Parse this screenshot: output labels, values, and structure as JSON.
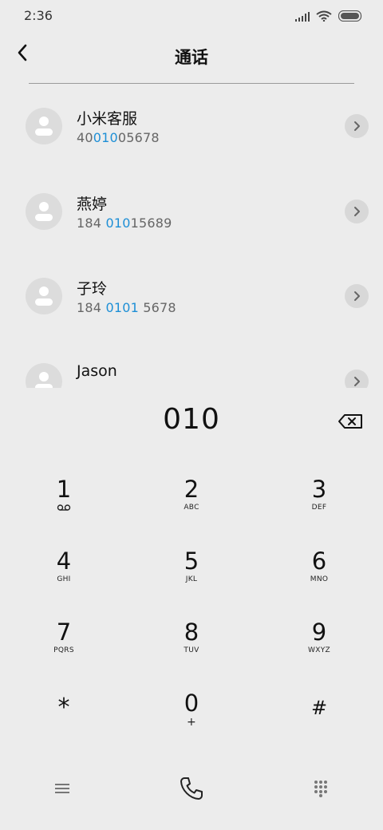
{
  "status_bar": {
    "time": "2:36",
    "icons": [
      "signal-icon",
      "wifi-icon",
      "battery-icon"
    ]
  },
  "header": {
    "title": "通话",
    "back_icon": "chevron-left-icon"
  },
  "contacts": [
    {
      "name": "小米客服",
      "number_parts": [
        "40",
        "010",
        "05678"
      ]
    },
    {
      "name": "燕婷",
      "number_parts": [
        "184 ",
        "010",
        "15689"
      ]
    },
    {
      "name": "子玲",
      "number_parts": [
        "184 ",
        "0101",
        " 5678"
      ]
    },
    {
      "name": "Jason",
      "number_parts": [
        "",
        "",
        ""
      ]
    }
  ],
  "dialer": {
    "input_value": "010",
    "backspace_icon": "backspace-icon",
    "keys": [
      {
        "digit": "1",
        "letters": ""
      },
      {
        "digit": "2",
        "letters": "ABC"
      },
      {
        "digit": "3",
        "letters": "DEF"
      },
      {
        "digit": "4",
        "letters": "GHI"
      },
      {
        "digit": "5",
        "letters": "JKL"
      },
      {
        "digit": "6",
        "letters": "MNO"
      },
      {
        "digit": "7",
        "letters": "PQRS"
      },
      {
        "digit": "8",
        "letters": "TUV"
      },
      {
        "digit": "9",
        "letters": "WXYZ"
      },
      {
        "digit": "*",
        "letters": ""
      },
      {
        "digit": "0",
        "letters": "+"
      },
      {
        "digit": "#",
        "letters": ""
      }
    ]
  },
  "bottom_bar": {
    "icons": [
      "menu-icon",
      "phone-call-icon",
      "dialpad-icon"
    ]
  },
  "colors": {
    "background": "#ececec",
    "highlight": "#1e8fd6",
    "secondary_text": "#666666"
  }
}
